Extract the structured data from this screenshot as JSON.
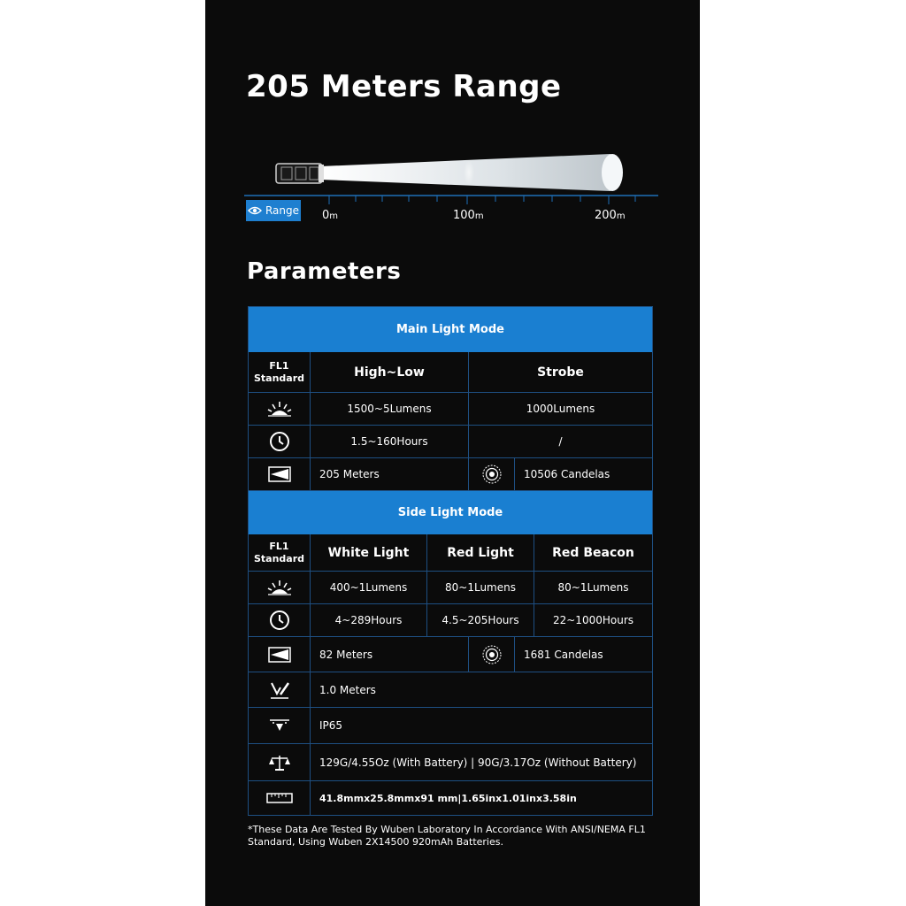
{
  "headline": "205 Meters Range",
  "range_diagram": {
    "badge_label": "Range",
    "badge_icon": "eye-icon",
    "ticks": [
      {
        "value": "0",
        "unit": "m"
      },
      {
        "value": "100",
        "unit": "m"
      },
      {
        "value": "200",
        "unit": "m"
      }
    ],
    "beam_range_m": 205
  },
  "parameters_title": "Parameters",
  "main_mode": {
    "title": "Main Light Mode",
    "standard": [
      "FL1",
      "Standard"
    ],
    "columns": [
      "High~Low",
      "Strobe"
    ],
    "lumens": [
      "1500~5Lumens",
      "1000Lumens"
    ],
    "runtime": [
      "1.5~160Hours",
      "/"
    ],
    "distance": "205 Meters",
    "intensity": "10506 Candelas"
  },
  "side_mode": {
    "title": "Side Light Mode",
    "standard": [
      "FL1",
      "Standard"
    ],
    "columns": [
      "White Light",
      "Red Light",
      "Red Beacon"
    ],
    "lumens": [
      "400~1Lumens",
      "80~1Lumens",
      "80~1Lumens"
    ],
    "runtime": [
      "4~289Hours",
      "4.5~205Hours",
      "22~1000Hours"
    ],
    "distance": "82 Meters",
    "intensity": "1681 Candelas",
    "impact": "1.0 Meters",
    "waterproof": "IP65",
    "weight": "129G/4.55Oz (With Battery) | 90G/3.17Oz (Without Battery)",
    "dimensions": "41.8mmx25.8mmx91 mm|1.65inx1.01inx3.58in"
  },
  "icons": {
    "lumens": "sunburst-icon",
    "runtime": "clock-icon",
    "distance": "beam-distance-icon",
    "intensity": "intensity-icon",
    "impact": "impact-resistance-icon",
    "waterproof": "waterproof-icon",
    "weight": "scale-icon",
    "dimensions": "ruler-icon"
  },
  "footnote": "*These Data Are Tested By Wuben Laboratory In Accordance With ANSI/NEMA FL1 Standard, Using Wuben 2X14500 920mAh Batteries.",
  "colors": {
    "background": "#0b0b0b",
    "accent": "#1a7fd1",
    "grid": "#1e4f82",
    "text": "#ffffff"
  }
}
